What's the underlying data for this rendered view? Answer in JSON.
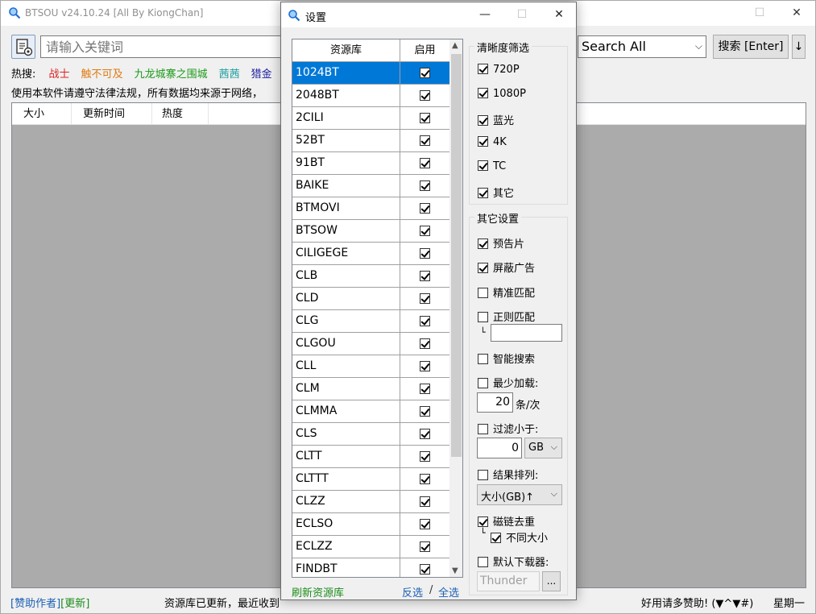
{
  "main": {
    "title": "BTSOU v24.10.24 [All By KiongChan]",
    "search_placeholder": "请输入关键词",
    "scope_value": "Search All",
    "search_button": "搜索 [Enter]",
    "more_button": "↓",
    "hot_label": "热搜:",
    "hot_items": [
      {
        "label": "战士",
        "color": "#e02020"
      },
      {
        "label": "触不可及",
        "color": "#e07a10"
      },
      {
        "label": "九龙城寨之围城",
        "color": "#1a9a1a"
      },
      {
        "label": "茜茜",
        "color": "#20a0a0"
      },
      {
        "label": "猎金",
        "color": "#1a1aa0"
      }
    ],
    "notice": "使用本软件请遵守法律法规，所有数据均来源于网络，",
    "columns": [
      "大小",
      "更新时间",
      "热度"
    ]
  },
  "status": {
    "sponsor": "[赞助作者]",
    "update": "[更新]",
    "message": "资源库已更新，最近收到",
    "message_tail": "好用请多赞助! (▼^▼#)",
    "day": "星期一"
  },
  "dialog": {
    "title": "设置",
    "grid_header_repo": "资源库",
    "grid_header_enabled": "启用",
    "repos": [
      {
        "name": "1024BT",
        "enabled": true,
        "selected": true
      },
      {
        "name": "2048BT",
        "enabled": true
      },
      {
        "name": "2CILI",
        "enabled": true
      },
      {
        "name": "52BT",
        "enabled": true
      },
      {
        "name": "91BT",
        "enabled": true
      },
      {
        "name": "BAIKE",
        "enabled": true
      },
      {
        "name": "BTMOVI",
        "enabled": true
      },
      {
        "name": "BTSOW",
        "enabled": true
      },
      {
        "name": "CILIGEGE",
        "enabled": true
      },
      {
        "name": "CLB",
        "enabled": true
      },
      {
        "name": "CLD",
        "enabled": true
      },
      {
        "name": "CLG",
        "enabled": true
      },
      {
        "name": "CLGOU",
        "enabled": true
      },
      {
        "name": "CLL",
        "enabled": true
      },
      {
        "name": "CLM",
        "enabled": true
      },
      {
        "name": "CLMMA",
        "enabled": true
      },
      {
        "name": "CLS",
        "enabled": true
      },
      {
        "name": "CLTT",
        "enabled": true
      },
      {
        "name": "CLTTT",
        "enabled": true
      },
      {
        "name": "CLZZ",
        "enabled": true
      },
      {
        "name": "ECLSO",
        "enabled": true
      },
      {
        "name": "ECLZZ",
        "enabled": true
      },
      {
        "name": "FINDBT",
        "enabled": true
      }
    ],
    "refresh_link": "刷新资源库",
    "invert_link": "反选",
    "separator": "/",
    "select_all_link": "全选",
    "quality_group": {
      "legend": "清晰度筛选",
      "options": [
        {
          "label": "720P",
          "checked": true
        },
        {
          "label": "1080P",
          "checked": true
        },
        {
          "label": "蓝光",
          "checked": true
        },
        {
          "label": "4K",
          "checked": true
        },
        {
          "label": "TC",
          "checked": true
        },
        {
          "label": "其它",
          "checked": true
        }
      ]
    },
    "other_group": {
      "legend": "其它设置",
      "trailer": {
        "label": "预告片",
        "checked": true
      },
      "block_ads": {
        "label": "屏蔽广告",
        "checked": true
      },
      "exact_match": {
        "label": "精准匹配",
        "checked": false
      },
      "regex_match": {
        "label": "正则匹配",
        "checked": false
      },
      "regex_value": "",
      "smart_search": {
        "label": "智能搜索",
        "checked": false
      },
      "min_load": {
        "label": "最少加载:",
        "checked": false
      },
      "min_load_value": "20",
      "min_load_unit": "条/次",
      "filter_less": {
        "label": "过滤小于:",
        "checked": false
      },
      "filter_value": "0",
      "filter_unit": "GB",
      "sort": {
        "label": "结果排列:",
        "checked": false
      },
      "sort_value": "大小(GB)↑",
      "dedupe": {
        "label": "磁链去重",
        "checked": true
      },
      "diff_size": {
        "label": "不同大小",
        "checked": true
      },
      "default_downloader": {
        "label": "默认下载器:",
        "checked": false
      },
      "downloader_value": "Thunder",
      "browse_label": "..."
    }
  },
  "colors": {
    "accent": "#0078d7",
    "link_blue": "#1a5fb4",
    "link_green": "#1a8c1a",
    "result_bg": "#ababab"
  }
}
